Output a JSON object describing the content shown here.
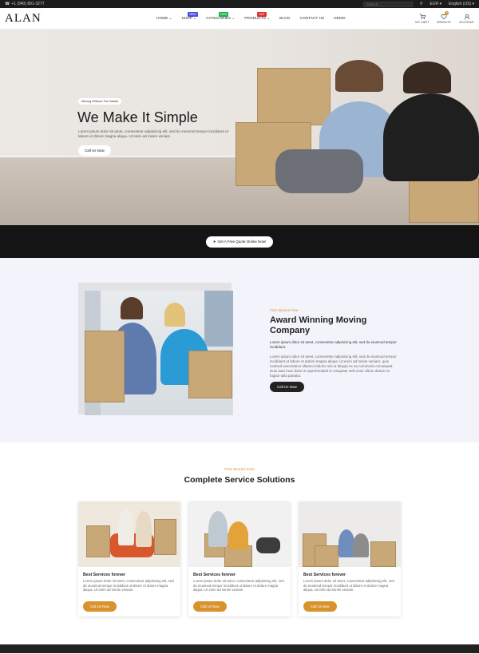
{
  "topbar": {
    "phone": "+1 (940) 891-3277",
    "search_placeholder": "Search...",
    "currency": "EUR",
    "language": "English (US)"
  },
  "header": {
    "logo": "ALAN",
    "nav": [
      {
        "label": "HOME",
        "badge": "",
        "caret": true
      },
      {
        "label": "SHOP",
        "badge": "NEW",
        "badge_color": "#4b4ee0",
        "caret": true
      },
      {
        "label": "CATEGORIES",
        "badge": "NEW",
        "badge_color": "#19b24a",
        "caret": true
      },
      {
        "label": "PRODUCTS",
        "badge": "HOT",
        "badge_color": "#e0322f",
        "caret": true
      },
      {
        "label": "BLOG",
        "badge": "",
        "caret": false
      },
      {
        "label": "CONTACT US",
        "badge": "",
        "caret": false
      },
      {
        "label": "DEMO",
        "badge": "",
        "caret": false
      }
    ],
    "icons": [
      {
        "label": "MY CART",
        "icon": "cart-icon",
        "count": ""
      },
      {
        "label": "WISHLIST",
        "icon": "heart-icon",
        "count": "0"
      },
      {
        "label": "ACCOUNT",
        "icon": "user-icon",
        "count": ""
      }
    ]
  },
  "hero": {
    "tag": "Moving Without The Hassle",
    "title": "We Make It Simple",
    "text": "Lorem ipsum dolor sit amet, consectetur adipisicing elit, sed do eiusmod tempor incididunt ut labore et dolore magna aliqua. Ut enim ad minim veniam",
    "button": "Call Us Now"
  },
  "band": {
    "button": "Get A Free Quote Online Now!"
  },
  "about": {
    "kicker": "First Service Free",
    "title": "Award Winning Moving Company",
    "lead": "Lorem ipsum dolor sit amet, consectetur adipisicing elit, sed do eiusmod tempor incididunt.",
    "body": "Lorem ipsum dolor sit amet, consectetur adipisicing elit, sed do eiusmod tempor incididunt ut labore et dolore magna aliqua. Ut enim ad minim veniam, quis nostrud exercitation ullamco laboris nisi ut aliquip ex ea commodo consequat. Duis aute irure dolor in reprehenderit in voluptate velit esse cillum dolore eu fugiat nulla pariatur.",
    "button": "Call Us Now"
  },
  "services": {
    "kicker": "First Service Free",
    "title": "Complete Service Solutions",
    "cards": [
      {
        "title": "Best Services forever",
        "text": "Lorem ipsum dolor sit amet, consectetur adipisicing elit, sed do eiusmod tempor incididunt ut labore et dolore magna aliqua. Ut enim ad minim veniam.",
        "button": "Call Us Now"
      },
      {
        "title": "Best Services forever",
        "text": "Lorem ipsum dolor sit amet, consectetur adipisicing elit, sed do eiusmod tempor incididunt ut labore et dolore magna aliqua. Ut enim ad minim veniam.",
        "button": "Call Us Now"
      },
      {
        "title": "Best Services forever",
        "text": "Lorem ipsum dolor sit amet, consectetur adipisicing elit, sed do eiusmod tempor incididunt ut labore et dolore magna aliqua. Ut enim ad minim veniam.",
        "button": "Call Us Now"
      }
    ]
  },
  "colors": {
    "accent": "#d9922e",
    "dark": "#141414",
    "section_bg": "#f3f3fb"
  }
}
